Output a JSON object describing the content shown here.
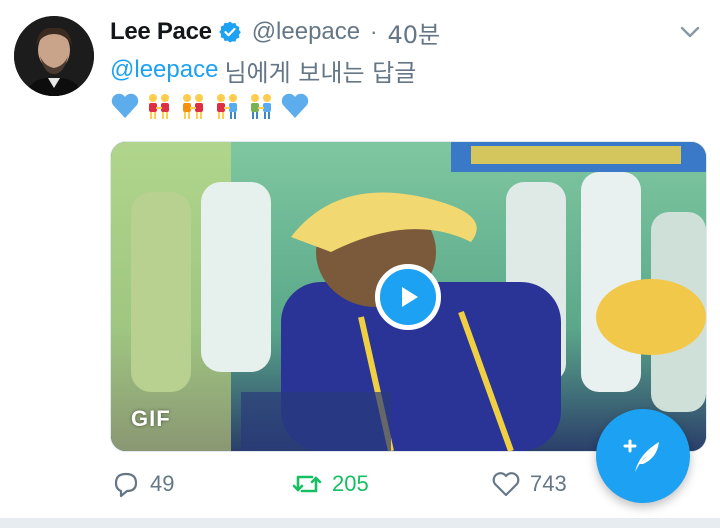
{
  "tweet": {
    "author_name": "Lee Pace",
    "handle": "@leepace",
    "separator": "·",
    "time": "40분",
    "reply_to_mention": "@leepace",
    "reply_to_suffix": "님에게 보내는 답글",
    "emojis": [
      "blue-heart-icon",
      "women-holding-hands-icon",
      "women-holding-hands-icon",
      "man-and-woman-holding-hands-icon",
      "men-holding-hands-icon",
      "blue-heart-icon"
    ],
    "media_badge": "GIF"
  },
  "actions": {
    "reply_count": "49",
    "retweet_count": "205",
    "like_count": "743"
  },
  "colors": {
    "accent": "#1da1f2",
    "retweet": "#17bf63",
    "muted": "#657786"
  }
}
